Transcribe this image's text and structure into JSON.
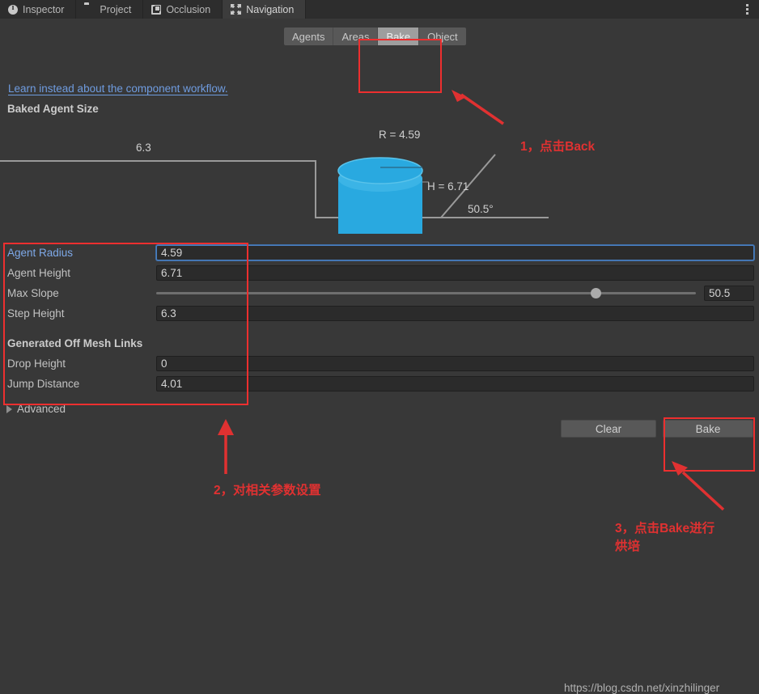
{
  "window_tabs": [
    {
      "label": "Inspector",
      "icon": "info-icon",
      "active": false
    },
    {
      "label": "Project",
      "icon": "folder-icon",
      "active": false
    },
    {
      "label": "Occlusion",
      "icon": "occlusion-icon",
      "active": false
    },
    {
      "label": "Navigation",
      "icon": "navigation-icon",
      "active": true
    }
  ],
  "window_menu_icon": "kebab-menu-icon",
  "mode_tabs": [
    {
      "label": "Agents",
      "active": false
    },
    {
      "label": "Areas",
      "active": false
    },
    {
      "label": "Bake",
      "active": true
    },
    {
      "label": "Object",
      "active": false
    }
  ],
  "learn_link": "Learn instead about the component workflow.",
  "section_title": "Baked Agent Size",
  "diagram": {
    "radius_label": "R = 4.59",
    "height_label": "H = 6.71",
    "angle_label": "50.5°",
    "step_label": "6.3",
    "agent_color": "#29a9e0",
    "line_color": "#9a9a9a"
  },
  "properties": [
    {
      "label": "Agent Radius",
      "value": "4.59",
      "type": "field",
      "selected": true,
      "focused": true
    },
    {
      "label": "Agent Height",
      "value": "6.71",
      "type": "field",
      "selected": false,
      "focused": false
    },
    {
      "label": "Max Slope",
      "value": "50.5",
      "type": "slider",
      "selected": false,
      "focused": false,
      "slider_percent": 81.5
    },
    {
      "label": "Step Height",
      "value": "6.3",
      "type": "field",
      "selected": false,
      "focused": false
    }
  ],
  "offmesh_header": "Generated Off Mesh Links",
  "offmesh_properties": [
    {
      "label": "Drop Height",
      "value": "0",
      "type": "field"
    },
    {
      "label": "Jump Distance",
      "value": "4.01",
      "type": "field"
    }
  ],
  "advanced_label": "Advanced",
  "advanced_icon": "triangle-right-icon",
  "buttons": {
    "clear": "Clear",
    "bake": "Bake"
  },
  "watermark": "https://blog.csdn.net/xinzhilinger",
  "annotations": {
    "color": "#e03131",
    "step1": "1，点击Back",
    "step2": "2，对相关参数设置",
    "step3": "3，点击Bake进行\n烘培"
  }
}
